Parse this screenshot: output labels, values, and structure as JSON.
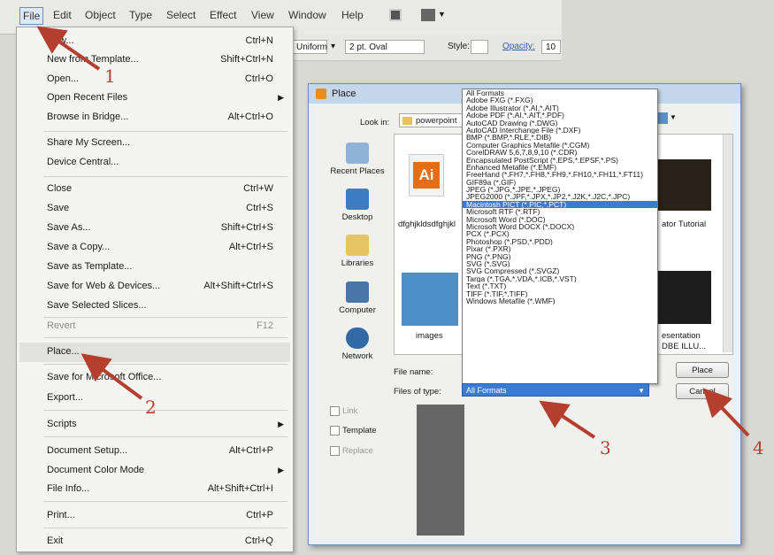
{
  "menubar": {
    "items": [
      "File",
      "Edit",
      "Object",
      "Type",
      "Select",
      "Effect",
      "View",
      "Window",
      "Help"
    ]
  },
  "controlbar": {
    "uniform": "Uniform",
    "stroke_size": "2 pt. Oval",
    "style_label": "Style:",
    "opacity_label": "Opacity:",
    "opacity_value": "10"
  },
  "file_menu": {
    "items": [
      {
        "label": "New...",
        "shortcut": "Ctrl+N"
      },
      {
        "label": "New from Template...",
        "shortcut": "Shift+Ctrl+N"
      },
      {
        "label": "Open...",
        "shortcut": "Ctrl+O"
      },
      {
        "label": "Open Recent Files",
        "shortcut": ""
      },
      {
        "label": "Browse in Bridge...",
        "shortcut": "Alt+Ctrl+O"
      },
      {
        "label": "Share My Screen...",
        "shortcut": ""
      },
      {
        "label": "Device Central...",
        "shortcut": ""
      },
      {
        "label": "Close",
        "shortcut": "Ctrl+W"
      },
      {
        "label": "Save",
        "shortcut": "Ctrl+S"
      },
      {
        "label": "Save As...",
        "shortcut": "Shift+Ctrl+S"
      },
      {
        "label": "Save a Copy...",
        "shortcut": "Alt+Ctrl+S"
      },
      {
        "label": "Save as Template...",
        "shortcut": ""
      },
      {
        "label": "Save for Web & Devices...",
        "shortcut": "Alt+Shift+Ctrl+S"
      },
      {
        "label": "Save Selected Slices...",
        "shortcut": ""
      },
      {
        "label": "Revert",
        "shortcut": "F12"
      },
      {
        "label": "Place...",
        "shortcut": ""
      },
      {
        "label": "Save for Microsoft Office...",
        "shortcut": ""
      },
      {
        "label": "Export...",
        "shortcut": ""
      },
      {
        "label": "Scripts",
        "shortcut": ""
      },
      {
        "label": "Document Setup...",
        "shortcut": "Alt+Ctrl+P"
      },
      {
        "label": "Document Color Mode",
        "shortcut": ""
      },
      {
        "label": "File Info...",
        "shortcut": "Alt+Shift+Ctrl+I"
      },
      {
        "label": "Print...",
        "shortcut": "Ctrl+P"
      },
      {
        "label": "Exit",
        "shortcut": "Ctrl+Q"
      }
    ]
  },
  "place_dialog": {
    "title": "Place",
    "look_in_label": "Look in:",
    "look_in_value": "powerpoint",
    "places": [
      "Recent Places",
      "Desktop",
      "Libraries",
      "Computer",
      "Network"
    ],
    "files": [
      "dfghjkldsdfghjkl",
      "ator Tutorial",
      "images",
      "esentation",
      "DBE ILLU..."
    ],
    "file_name_label": "File name:",
    "files_of_type_label": "Files of type:",
    "files_of_type_value": "All Formats",
    "place_button": "Place",
    "cancel_button": "Cancel",
    "options": [
      "Link",
      "Template",
      "Replace"
    ],
    "file_types": [
      "All Formats",
      "Adobe FXG (*.FXG)",
      "Adobe Illustrator (*.AI,*.AIT)",
      "Adobe PDF (*.AI,*.AIT,*.PDF)",
      "AutoCAD Drawing (*.DWG)",
      "AutoCAD Interchange File (*.DXF)",
      "BMP (*.BMP,*.RLE,*.DIB)",
      "Computer Graphics Metafile (*.CGM)",
      "CorelDRAW 5,6,7,8,9,10 (*.CDR)",
      "Encapsulated PostScript (*.EPS,*.EPSF,*.PS)",
      "Enhanced Metafile (*.EMF)",
      "FreeHand (*.FH7,*.FH8,*.FH9,*.FH10,*.FH11,*.FT11)",
      "GIF89a (*.GIF)",
      "JPEG (*.JPG,*.JPE,*.JPEG)",
      "JPEG2000 (*.JPF,*.JPX,*.JP2,*.J2K,*.J2C,*.JPC)",
      "Macintosh PICT (*.PIC,*.PCT)",
      "Microsoft RTF (*.RTF)",
      "Microsoft Word (*.DOC)",
      "Microsoft Word DOCX (*.DOCX)",
      "PCX (*.PCX)",
      "Photoshop (*.PSD,*.PDD)",
      "Pixar (*.PXR)",
      "PNG (*.PNG)",
      "SVG (*.SVG)",
      "SVG Compressed (*.SVGZ)",
      "Targa (*.TGA,*.VDA,*.ICB,*.VST)",
      "Text (*.TXT)",
      "TIFF (*.TIF,*.TIFF)",
      "Windows Metafile (*.WMF)"
    ],
    "selected_type_index": 15
  },
  "annotations": [
    "1",
    "2",
    "3",
    "4"
  ],
  "colors": {
    "accent_red": "#b53f2e",
    "selection_blue": "#3a7bd5"
  }
}
